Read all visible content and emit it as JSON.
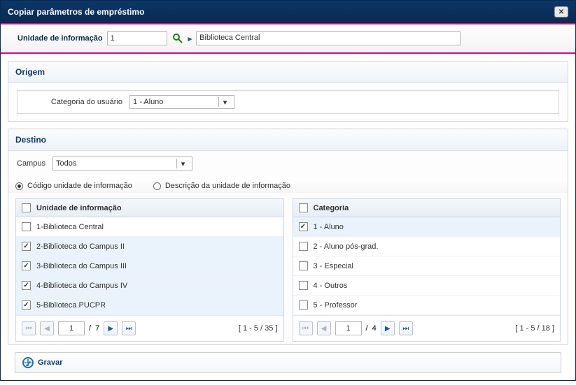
{
  "dialog": {
    "title": "Copiar parâmetros de empréstimo"
  },
  "unit": {
    "label": "Unidade de informação",
    "code": "1",
    "name": "Biblioteca Central"
  },
  "origin": {
    "title": "Origem",
    "categoria_label": "Categoria do usuário",
    "categoria_value": "1 - Aluno"
  },
  "destino": {
    "title": "Destino",
    "campus_label": "Campus",
    "campus_value": "Todos",
    "radio_codigo": "Código unidade de informação",
    "radio_descricao": "Descrição da unidade de informação"
  },
  "unitPanel": {
    "header": "Unidade de informação",
    "items": [
      {
        "label": "1-Biblioteca Central",
        "checked": false
      },
      {
        "label": "2-Biblioteca do Campus II",
        "checked": true
      },
      {
        "label": "3-Biblioteca do Campus III",
        "checked": true
      },
      {
        "label": "4-Biblioteca do Campus IV",
        "checked": true
      },
      {
        "label": "5-Biblioteca PUCPR",
        "checked": true
      }
    ],
    "page": "1",
    "total_pages": "7",
    "range": "[ 1 - 5 / 35 ]",
    "slash": "/"
  },
  "catPanel": {
    "header": "Categoria",
    "items": [
      {
        "label": "1 - Aluno",
        "checked": true
      },
      {
        "label": "2 - Aluno pós-grad.",
        "checked": false
      },
      {
        "label": "3 - Especial",
        "checked": false
      },
      {
        "label": "4 - Outros",
        "checked": false
      },
      {
        "label": "5 - Professor",
        "checked": false
      }
    ],
    "page": "1",
    "total_pages": "4",
    "range": "[ 1 - 5 / 18 ]",
    "slash": "/"
  },
  "action": {
    "gravar": "Gravar"
  }
}
